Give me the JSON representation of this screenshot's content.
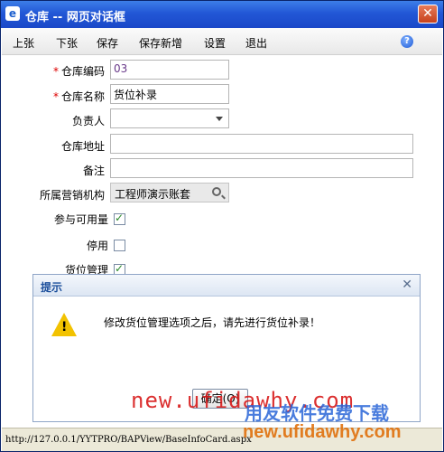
{
  "window": {
    "title": "仓库 -- 网页对话框",
    "ie_icon": "ie-icon",
    "close_glyph": "✕"
  },
  "toolbar": {
    "items": [
      "上张",
      "下张",
      "保存",
      "保存新增",
      "设置",
      "退出"
    ],
    "help_glyph": "?"
  },
  "form": {
    "code_label": "仓库编码",
    "code_value": "03",
    "name_label": "仓库名称",
    "name_value": "货位补录",
    "manager_label": "负责人",
    "manager_value": "",
    "address_label": "仓库地址",
    "address_value": "",
    "remark_label": "备注",
    "remark_value": "",
    "org_label": "所属营销机构",
    "org_value": "工程师演示账套",
    "available_label": "参与可用量",
    "available_checked": true,
    "disabled_label": "停用",
    "disabled_checked": false,
    "location_label": "货位管理",
    "location_checked": true,
    "required_mark": "*"
  },
  "dialog": {
    "title": "提示",
    "close_glyph": "✕",
    "icon": "warning-icon",
    "message": "修改货位管理选项之后，请先进行货位补录！",
    "ok_label": "确定(O)"
  },
  "status": {
    "url": "http://127.0.0.1/YYTPRO/BAPView/BaseInfoCard.aspx"
  },
  "watermarks": {
    "line1": "new.ufidawhy.com",
    "line2": "用友软件免费下载",
    "line3": "new.ufidawhy.com"
  },
  "colors": {
    "title_bar": "#2257d6",
    "required": "#dd0000",
    "warning": "#f2c200"
  }
}
